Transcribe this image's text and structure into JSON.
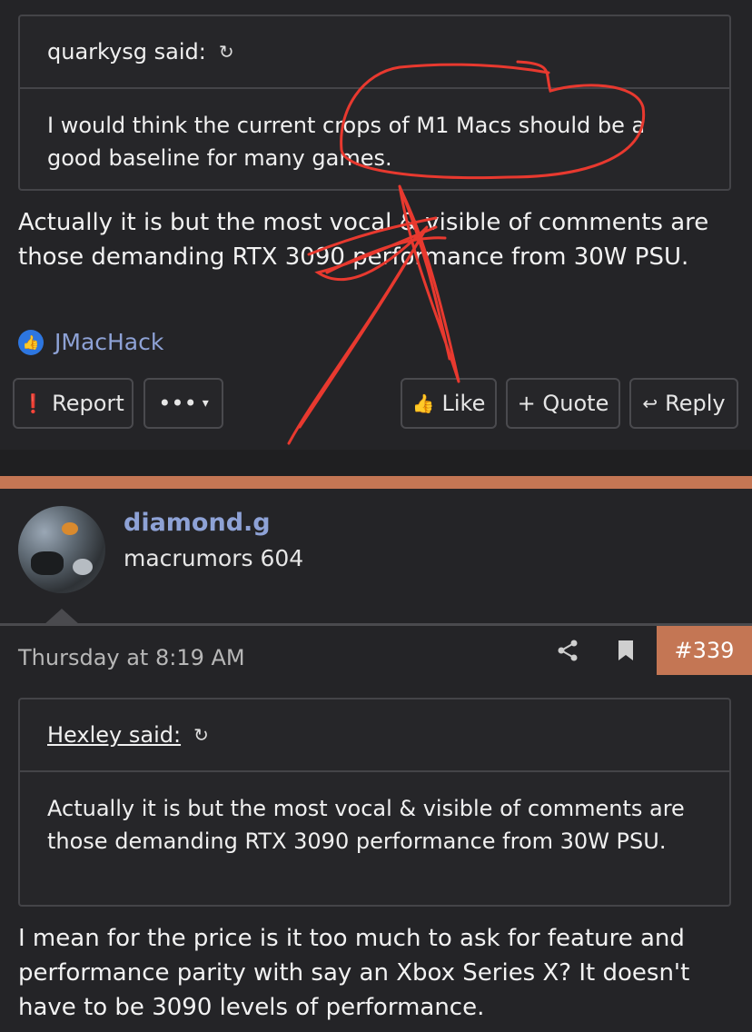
{
  "post1": {
    "quote": {
      "author_label": "quarkysg said:",
      "text": "I would think the current crops of M1 Macs should be a good baseline for many games."
    },
    "body": "Actually it is but the most vocal & visible of comments are those demanding RTX 3090 performance from 30W PSU.",
    "reaction_user": "JMacHack",
    "buttons": {
      "report": "Report",
      "more": "•••",
      "like": "Like",
      "quote": "+ Quote",
      "reply": "Reply"
    }
  },
  "post2": {
    "username": "diamond.g",
    "user_title": "macrumors 604",
    "timestamp": "Thursday at 8:19 AM",
    "post_number": "#339",
    "quote": {
      "author_label": "Hexley said:",
      "text": "Actually it is but the most vocal & visible of comments are those demanding RTX 3090 performance from 30W PSU."
    },
    "body": "I mean for the price is it too much to ask for feature and performance parity with say an Xbox Series X? It doesn't have to be 3090 levels of performance."
  },
  "colors": {
    "accent": "#c47654",
    "link": "#8ea2d6",
    "annotation": "#e8392f"
  },
  "icons": [
    "return-arrow-icon",
    "thumbs-up-icon",
    "alert-icon",
    "chevron-down-icon",
    "reply-arrow-icon",
    "share-icon",
    "bookmark-icon"
  ]
}
